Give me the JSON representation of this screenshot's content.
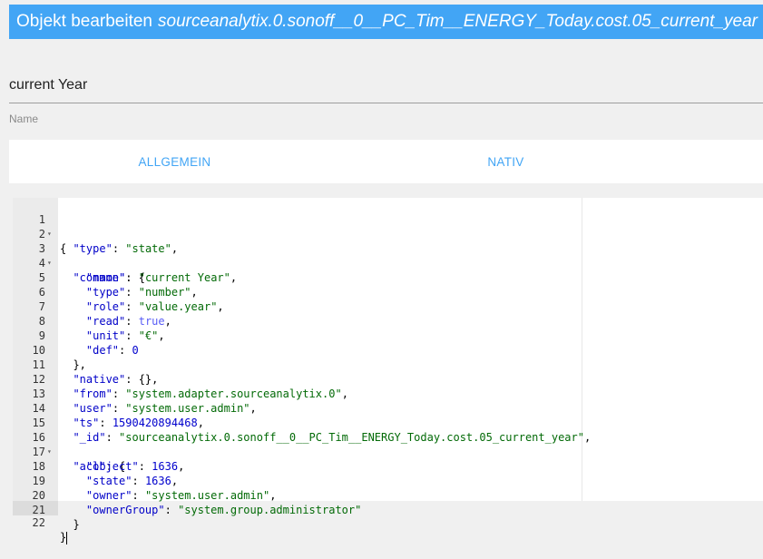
{
  "dialog": {
    "title_prefix": "Objekt bearbeiten",
    "object_id": "sourceanalytix.0.sonoff__0__PC_Tim__ENERGY_Today.cost.05_current_year"
  },
  "name_field": {
    "value": "current Year",
    "label": "Name"
  },
  "tabs": [
    {
      "label": "ALLGEMEIN"
    },
    {
      "label": "NATIV"
    }
  ],
  "editor": {
    "lines": [
      {
        "n": "1",
        "fold": true
      },
      {
        "n": "2"
      },
      {
        "n": "3",
        "fold": true
      },
      {
        "n": "4"
      },
      {
        "n": "5"
      },
      {
        "n": "6"
      },
      {
        "n": "7"
      },
      {
        "n": "8"
      },
      {
        "n": "9"
      },
      {
        "n": "10"
      },
      {
        "n": "11"
      },
      {
        "n": "12"
      },
      {
        "n": "13"
      },
      {
        "n": "14"
      },
      {
        "n": "15"
      },
      {
        "n": "16",
        "fold": true
      },
      {
        "n": "17"
      },
      {
        "n": "18"
      },
      {
        "n": "19"
      },
      {
        "n": "20"
      },
      {
        "n": "21"
      },
      {
        "n": "22"
      }
    ],
    "json": {
      "k_type": "\"type\"",
      "v_type": "\"state\"",
      "k_common": "\"common\"",
      "k_name": "\"name\"",
      "v_name": "\"current Year\"",
      "k_ctype": "\"type\"",
      "v_ctype": "\"number\"",
      "k_role": "\"role\"",
      "v_role": "\"value.year\"",
      "k_read": "\"read\"",
      "v_read": "true",
      "k_unit": "\"unit\"",
      "v_unit": "\"€\"",
      "k_def": "\"def\"",
      "v_def": "0",
      "k_native": "\"native\"",
      "k_from": "\"from\"",
      "v_from": "\"system.adapter.sourceanalytix.0\"",
      "k_user": "\"user\"",
      "v_user": "\"system.user.admin\"",
      "k_ts": "\"ts\"",
      "v_ts": "1590420894468",
      "k_id": "\"_id\"",
      "v_id": "\"sourceanalytix.0.sonoff__0__PC_Tim__ENERGY_Today.cost.05_current_year\"",
      "k_acl": "\"acl\"",
      "k_object": "\"object\"",
      "v_object": "1636",
      "k_state": "\"state\"",
      "v_state": "1636",
      "k_owner": "\"owner\"",
      "v_owner": "\"system.user.admin\"",
      "k_ownerGroup": "\"ownerGroup\"",
      "v_ownerGroup": "\"system.group.administrator\""
    }
  }
}
